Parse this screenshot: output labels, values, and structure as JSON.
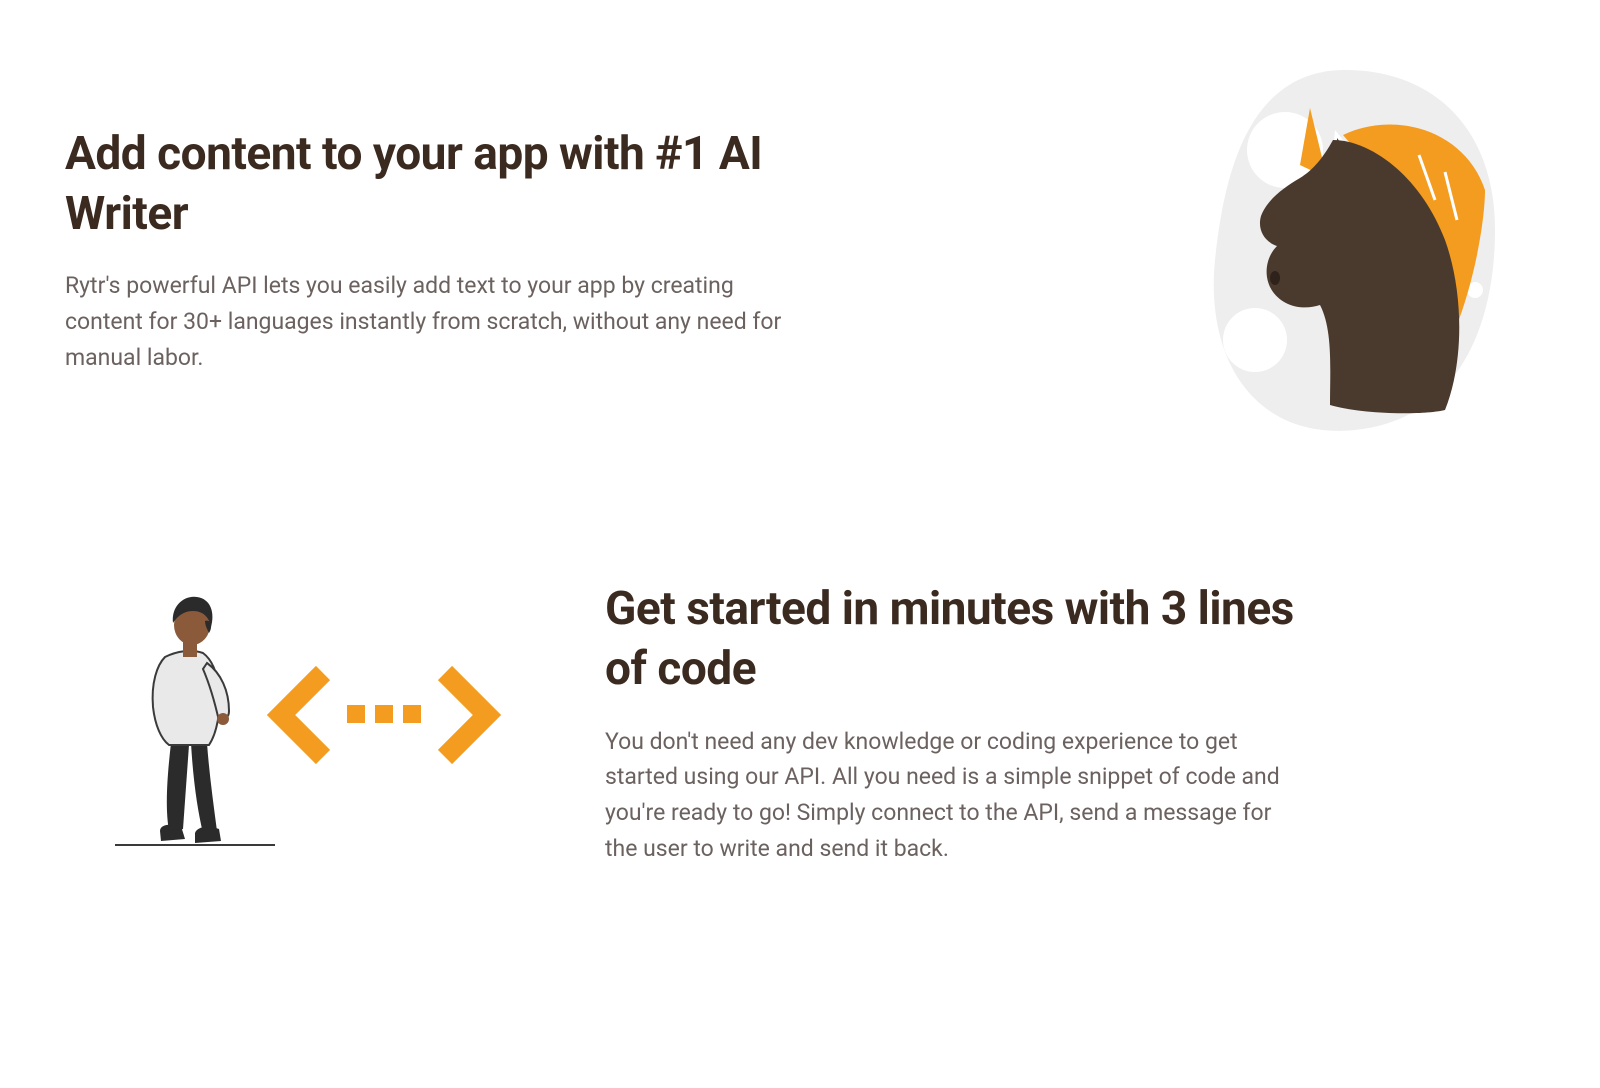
{
  "sections": [
    {
      "heading": "Add content to your app with #1 AI Writer",
      "body": "Rytr's powerful API lets you easily add text to your app by creating content for 30+ languages instantly from scratch, without any need for manual labor."
    },
    {
      "heading": "Get started in minutes with 3 lines of code",
      "body": "You don't need any dev knowledge or coding experience to get started using our API. All you need is a simple snippet of code and you're ready to go! Simply connect to the API, send a message for the user to write and send it back."
    }
  ],
  "illustrations": {
    "unicorn": "unicorn-illustration",
    "person_code": "person-code-illustration"
  },
  "colors": {
    "heading": "#3b2a1f",
    "body": "#6b6260",
    "accent": "#f39c1f",
    "dark": "#4a3a2e",
    "blob": "#eeeeee"
  }
}
